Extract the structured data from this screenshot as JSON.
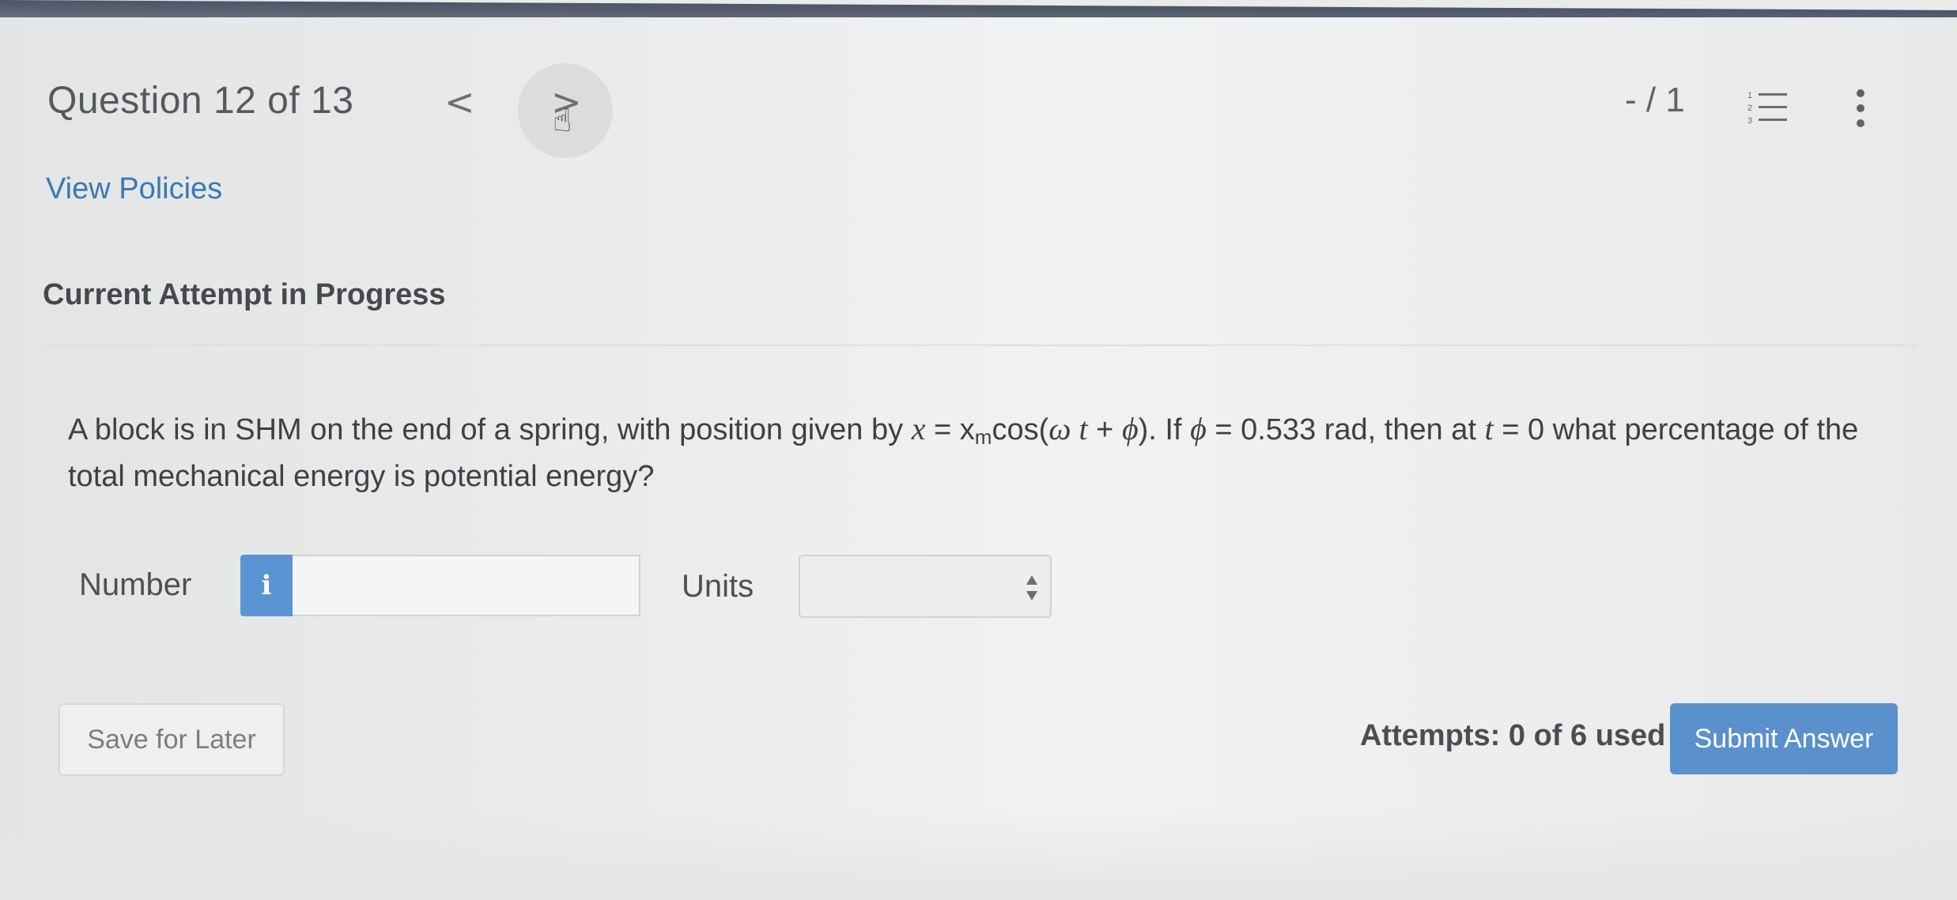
{
  "header": {
    "question_counter": "Question 12 of 13",
    "prev_glyph": "<",
    "next_glyph": ">",
    "score": "- / 1"
  },
  "links": {
    "view_policies": "View Policies"
  },
  "status": {
    "heading": "Current Attempt in Progress"
  },
  "question": {
    "text_1": "A block is in SHM on the end of a spring, with position given by ",
    "x_var": "x",
    "equals_1": " = ",
    "xm_base": "x",
    "xm_sub": "m",
    "cos_open": "cos(",
    "omega": "ω",
    "t_var": " t",
    "plus": " + ",
    "phi_1": "ϕ",
    "close_text": "). If ",
    "phi_2": "ϕ",
    "phi_value": " = 0.533 rad, then at ",
    "t_var_2": "t",
    "text_end": " = 0 what percentage of the total mechanical energy is potential energy?"
  },
  "answer": {
    "number_label": "Number",
    "info_glyph": "i",
    "number_value": "",
    "units_label": "Units",
    "units_selected": ""
  },
  "footer": {
    "save_label": "Save for Later",
    "attempts_text": "Attempts: 0 of 6 used",
    "submit_label": "Submit Answer"
  },
  "colors": {
    "link": "#3c78b5",
    "primary_button": "#5a90cc",
    "info_button": "#5b94d3"
  },
  "icons": {
    "prev": "chevron-left-icon",
    "next": "chevron-right-icon",
    "cursor": "hand-pointer-icon",
    "list": "numbered-list-icon",
    "more": "more-vertical-icon",
    "info": "info-icon"
  }
}
